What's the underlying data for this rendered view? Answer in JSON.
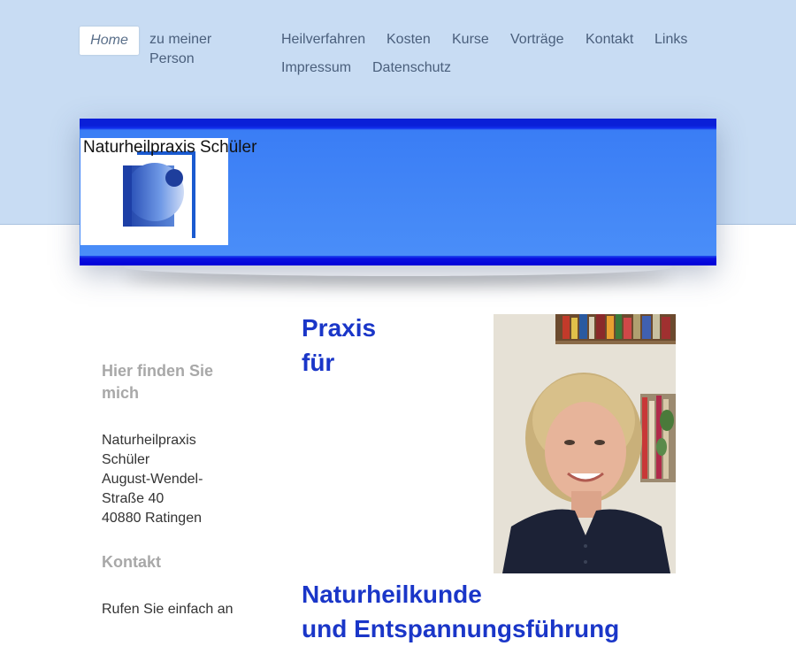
{
  "nav": {
    "home": "Home",
    "person_line1": "zu meiner",
    "person_line2": "Person",
    "heilverfahren": "Heilverfahren",
    "kosten": "Kosten",
    "kurse": "Kurse",
    "vortraege": "Vorträge",
    "kontakt": "Kontakt",
    "links": "Links",
    "impressum": "Impressum",
    "datenschutz": "Datenschutz"
  },
  "header": {
    "logo_text": "Naturheilpraxis Schüler"
  },
  "sidebar": {
    "find_heading_line1": "Hier finden Sie",
    "find_heading_line2": "mich",
    "address_lines": [
      "Naturheilpraxis",
      "Schüler",
      "August-Wendel-",
      "Straße 40",
      "40880 Ratingen"
    ],
    "contact_heading": "Kontakt",
    "contact_text": "Rufen Sie einfach an"
  },
  "main": {
    "title_line1": "Praxis",
    "title_line2": "für",
    "title_line3": "Naturheilkunde",
    "title_line4": "und Entspannungsführung"
  },
  "colors": {
    "top_band": "#c8dcf3",
    "banner_blue": "#4b8ff8",
    "banner_dark": "#0a1fd8",
    "title_blue": "#1a36c8"
  }
}
